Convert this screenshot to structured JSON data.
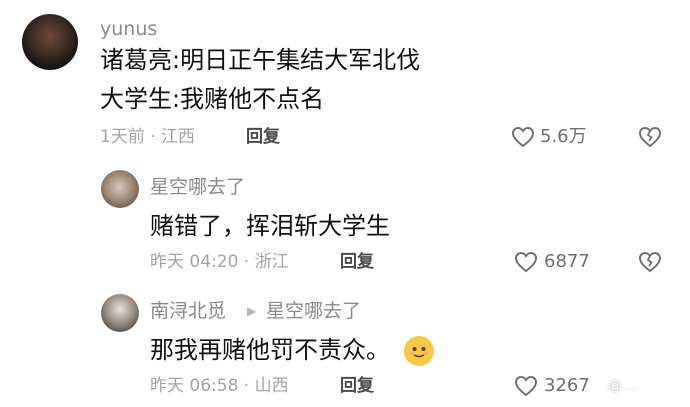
{
  "comments": [
    {
      "username": "yunus",
      "text_line1": "诸葛亮:明日正午集结大军北伐",
      "text_line2": "大学生:我赌他不点名",
      "time_location": "1天前 · 江西",
      "reply_label": "回复",
      "like_count": "5.6万"
    },
    {
      "username": "星空哪去了",
      "text": "赌错了，挥泪斩大学生",
      "time_location": "昨天 04:20 · 浙江",
      "reply_label": "回复",
      "like_count": "6877"
    },
    {
      "username": "南浔北觅",
      "reply_to": "星空哪去了",
      "text": "那我再赌他罚不责众。",
      "time_location": "昨天 06:58 · 山西",
      "reply_label": "回复",
      "like_count": "3267"
    }
  ],
  "icons": {
    "heart": "heart-outline-icon",
    "dislike": "broken-heart-icon",
    "reply_arrow": "triangle-right-icon",
    "emoji": "smiling-face-emoji"
  },
  "watermark": "@…"
}
